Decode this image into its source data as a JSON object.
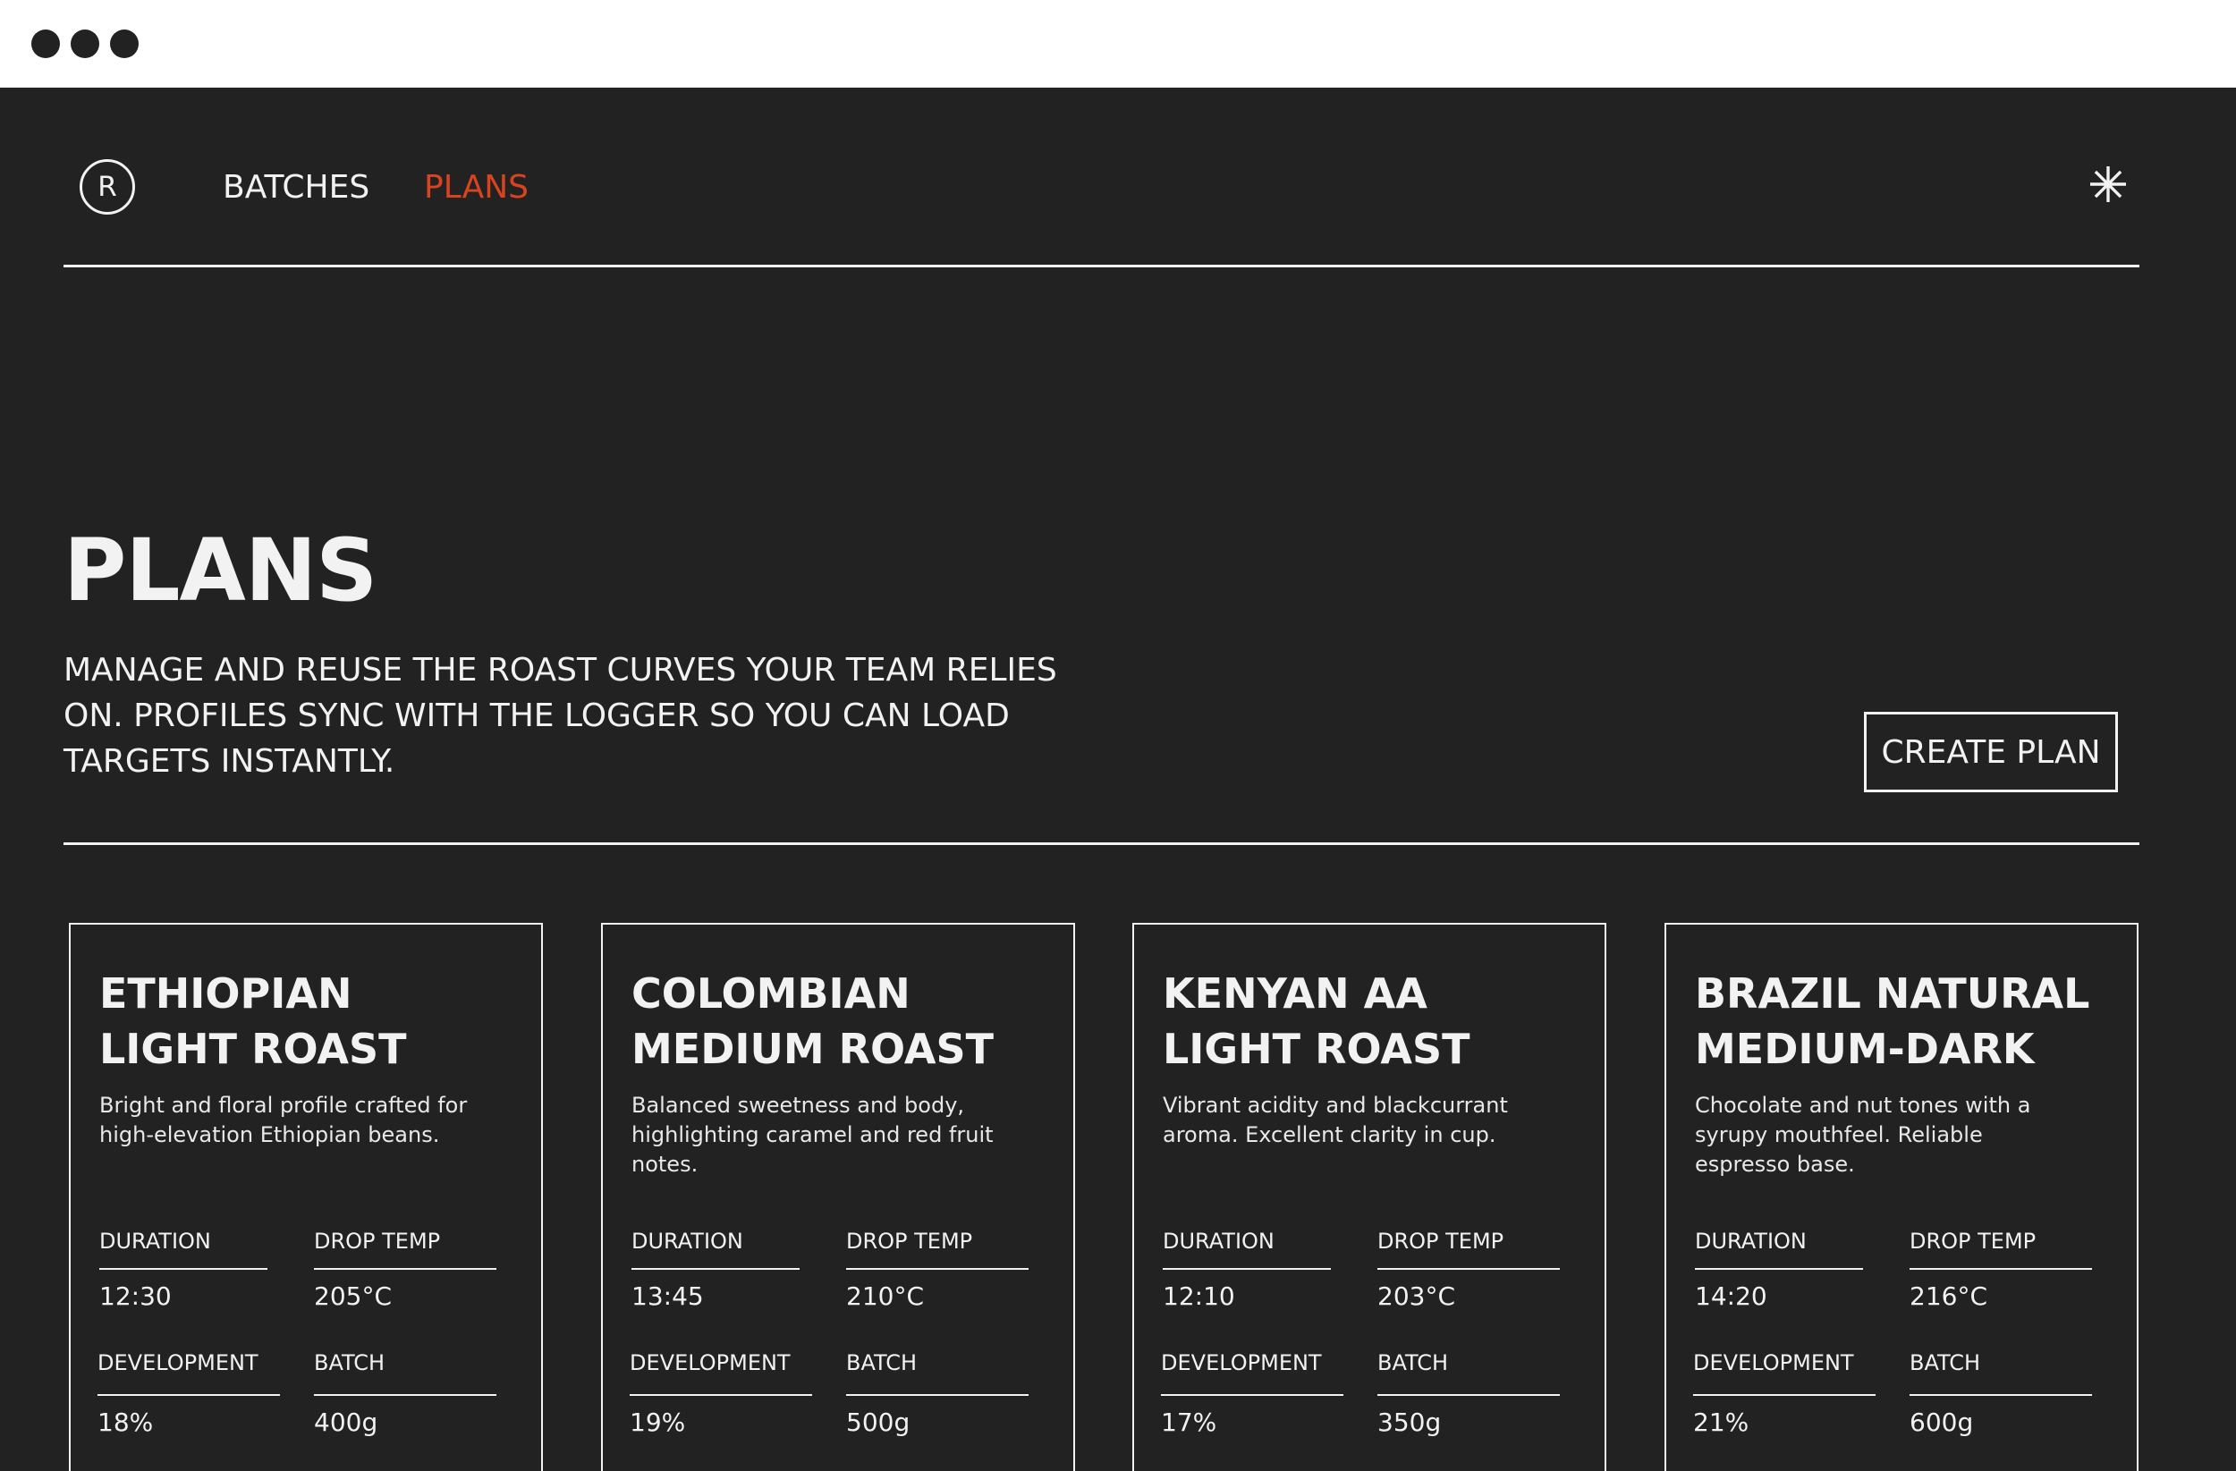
{
  "nav": {
    "logo_letter": "R",
    "items": [
      {
        "label": "BATCHES",
        "active": false
      },
      {
        "label": "PLANS",
        "active": true
      }
    ],
    "accent_color": "#d9431f",
    "settings_icon": "asterisk-icon"
  },
  "hero": {
    "title": "PLANS",
    "description": "MANAGE AND REUSE THE ROAST CURVES YOUR TEAM RELIES ON. PROFILES SYNC WITH THE LOGGER SO YOU CAN LOAD TARGETS INSTANTLY.",
    "create_button": "CREATE PLAN"
  },
  "metric_labels": {
    "duration": "DURATION",
    "drop_temp": "DROP TEMP",
    "development": "DEVELOPMENT",
    "batch": "BATCH"
  },
  "plans": [
    {
      "title_line1": "ETHIOPIAN",
      "title_line2": "LIGHT ROAST",
      "description": "Bright and floral profile crafted for high-elevation Ethiopian beans.",
      "duration": "12:30",
      "drop_temp": "205°C",
      "development": "18%",
      "batch": "400g"
    },
    {
      "title_line1": "COLOMBIAN",
      "title_line2": "MEDIUM ROAST",
      "description": "Balanced sweetness and body, highlighting caramel and red fruit notes.",
      "duration": "13:45",
      "drop_temp": "210°C",
      "development": "19%",
      "batch": "500g"
    },
    {
      "title_line1": "KENYAN AA",
      "title_line2": "LIGHT ROAST",
      "description": "Vibrant acidity and blackcurrant aroma. Excellent clarity in cup.",
      "duration": "12:10",
      "drop_temp": "203°C",
      "development": "17%",
      "batch": "350g"
    },
    {
      "title_line1": "BRAZIL NATURAL",
      "title_line2": "MEDIUM-DARK",
      "description": "Chocolate and nut tones with a syrupy mouthfeel. Reliable espresso base.",
      "duration": "14:20",
      "drop_temp": "216°C",
      "development": "21%",
      "batch": "600g"
    }
  ]
}
